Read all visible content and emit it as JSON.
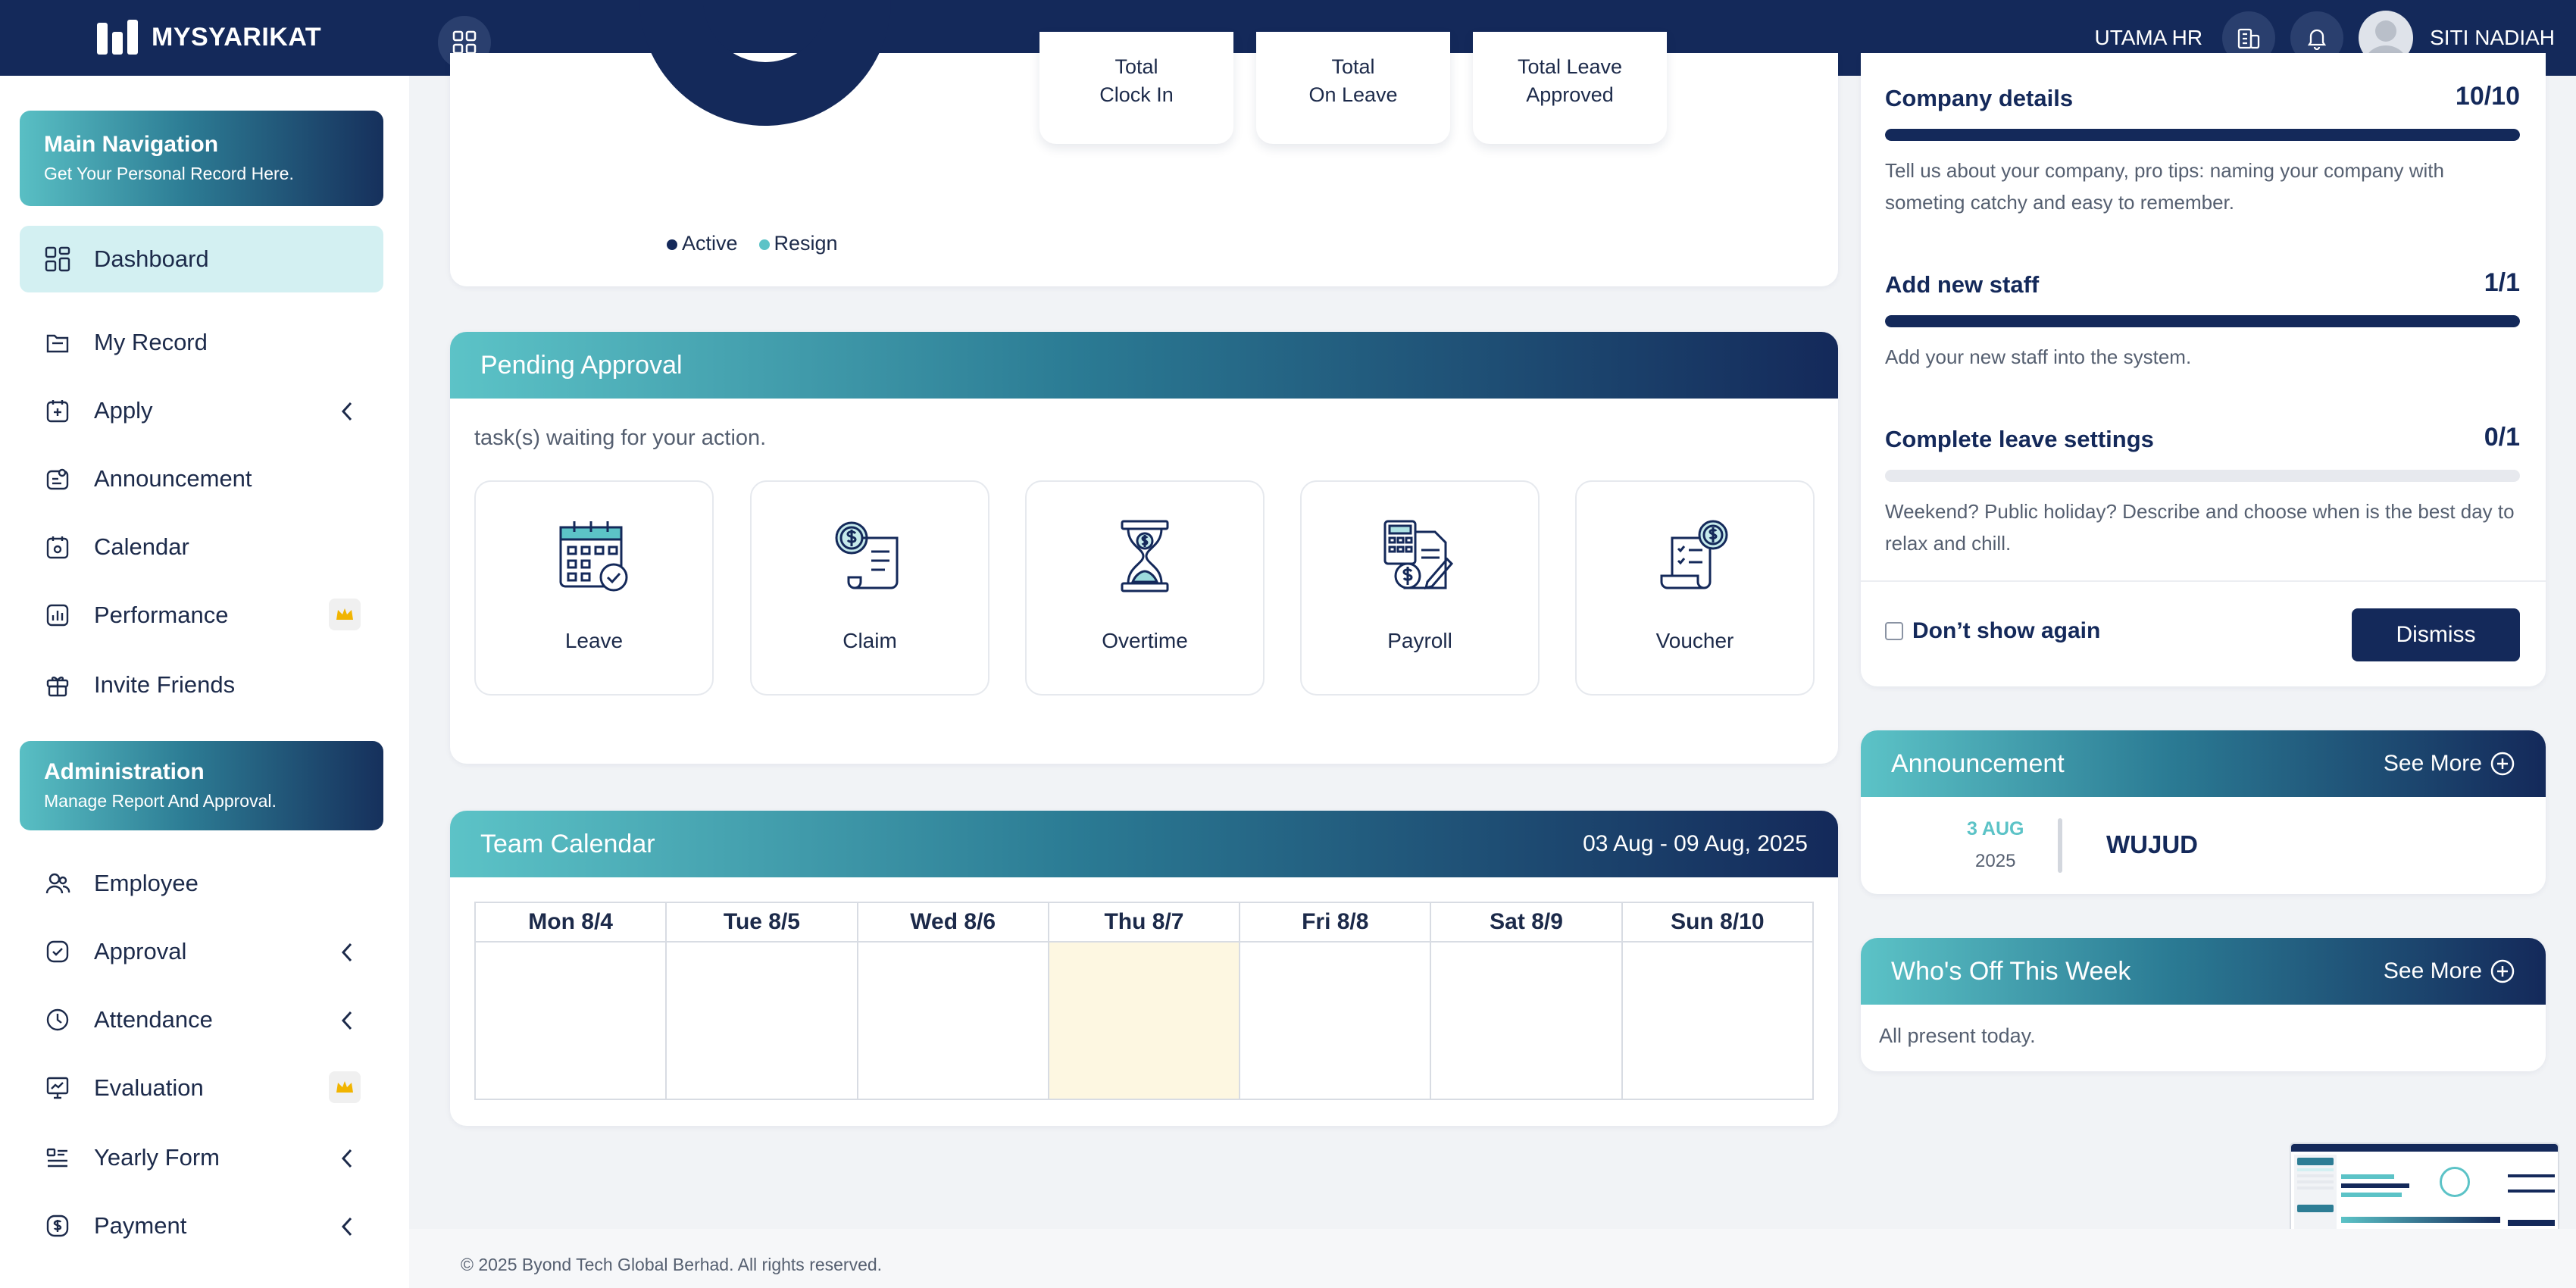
{
  "header": {
    "brand": "MYSYARIKAT",
    "company": "UTAMA HR",
    "user": "SITI NADIAH"
  },
  "sidebar": {
    "main_section": {
      "title": "Main Navigation",
      "subtitle": "Get Your Personal Record Here."
    },
    "main_items": [
      {
        "label": "Dashboard",
        "icon": "dashboard-icon"
      },
      {
        "label": "My Record",
        "icon": "folder-icon"
      },
      {
        "label": "Apply",
        "icon": "calendar-plus-icon"
      },
      {
        "label": "Announcement",
        "icon": "announcement-icon"
      },
      {
        "label": "Calendar",
        "icon": "calendar-icon"
      },
      {
        "label": "Performance",
        "icon": "chart-icon"
      },
      {
        "label": "Invite Friends",
        "icon": "gift-icon"
      }
    ],
    "admin_section": {
      "title": "Administration",
      "subtitle": "Manage Report And Approval."
    },
    "admin_items": [
      {
        "label": "Employee",
        "icon": "users-icon"
      },
      {
        "label": "Approval",
        "icon": "check-circle-icon"
      },
      {
        "label": "Attendance",
        "icon": "clock-icon"
      },
      {
        "label": "Evaluation",
        "icon": "presentation-icon"
      },
      {
        "label": "Yearly Form",
        "icon": "form-icon"
      },
      {
        "label": "Payment",
        "icon": "dollar-icon"
      }
    ]
  },
  "overview": {
    "legend": [
      "Active",
      "Resign"
    ],
    "stats": [
      {
        "line1": "Total",
        "line2": "Clock In"
      },
      {
        "line1": "Total",
        "line2": "On Leave"
      },
      {
        "line1": "Total Leave",
        "line2": "Approved"
      }
    ]
  },
  "pending_approval": {
    "title": "Pending Approval",
    "subtitle": "task(s) waiting for your action.",
    "tiles": [
      "Leave",
      "Claim",
      "Overtime",
      "Payroll",
      "Voucher"
    ]
  },
  "team_calendar": {
    "title": "Team Calendar",
    "range": "03 Aug - 09 Aug, 2025",
    "days": [
      "Mon 8/4",
      "Tue 8/5",
      "Wed 8/6",
      "Thu 8/7",
      "Fri 8/8",
      "Sat 8/9",
      "Sun 8/10"
    ]
  },
  "setup": {
    "tasks": [
      {
        "title": "Company details",
        "count": "10/10",
        "progress": 1.0,
        "desc": "Tell us about your company, pro tips: naming your company with someting catchy and easy to remember."
      },
      {
        "title": "Add new staff",
        "count": "1/1",
        "progress": 1.0,
        "desc": "Add your new staff into the system."
      },
      {
        "title": "Complete leave settings",
        "count": "0/1",
        "progress": 0.0,
        "desc": "Weekend? Public holiday? Describe and choose when is the best day to relax and chill."
      }
    ],
    "dont_show": "Don’t show again",
    "dismiss": "Dismiss"
  },
  "announcement": {
    "title": "Announcement",
    "see_more": "See More",
    "item": {
      "day": "3 AUG",
      "year": "2025",
      "title": "WUJUD"
    }
  },
  "whos_off": {
    "title": "Who's Off This Week",
    "see_more": "See More",
    "message": "All present today."
  },
  "footer": {
    "text": "© 2025 Byond Tech Global Berhad. All rights reserved."
  },
  "colors": {
    "navy": "#14295a",
    "teal": "#5cc3c7",
    "active_nav": "#d3f0f2",
    "today_cell": "#fdf7e1"
  }
}
